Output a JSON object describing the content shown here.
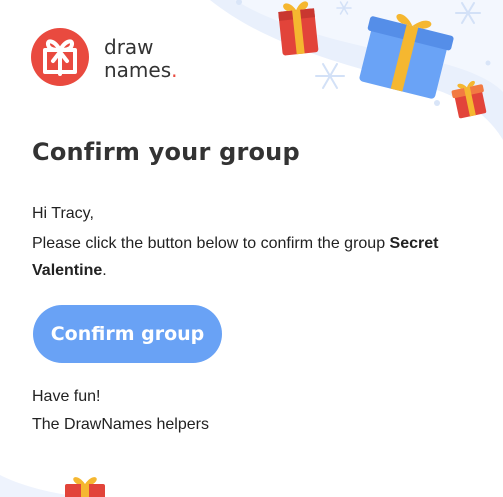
{
  "brand": {
    "line1": "draw",
    "line2": "names",
    "dot": "."
  },
  "email": {
    "title": "Confirm your group",
    "greeting": "Hi Tracy,",
    "body_prefix": "Please click the button below to confirm the group ",
    "group_name": "Secret Valentine",
    "body_suffix": ".",
    "button_label": "Confirm group",
    "closing": "Have fun!",
    "signature": "The DrawNames helpers"
  },
  "colors": {
    "accent_button": "#69a2f5",
    "logo_red": "#e94a3f",
    "text": "#222222"
  },
  "icons": [
    "gift-icon",
    "snowflake-icon",
    "logo-gift-icon"
  ]
}
